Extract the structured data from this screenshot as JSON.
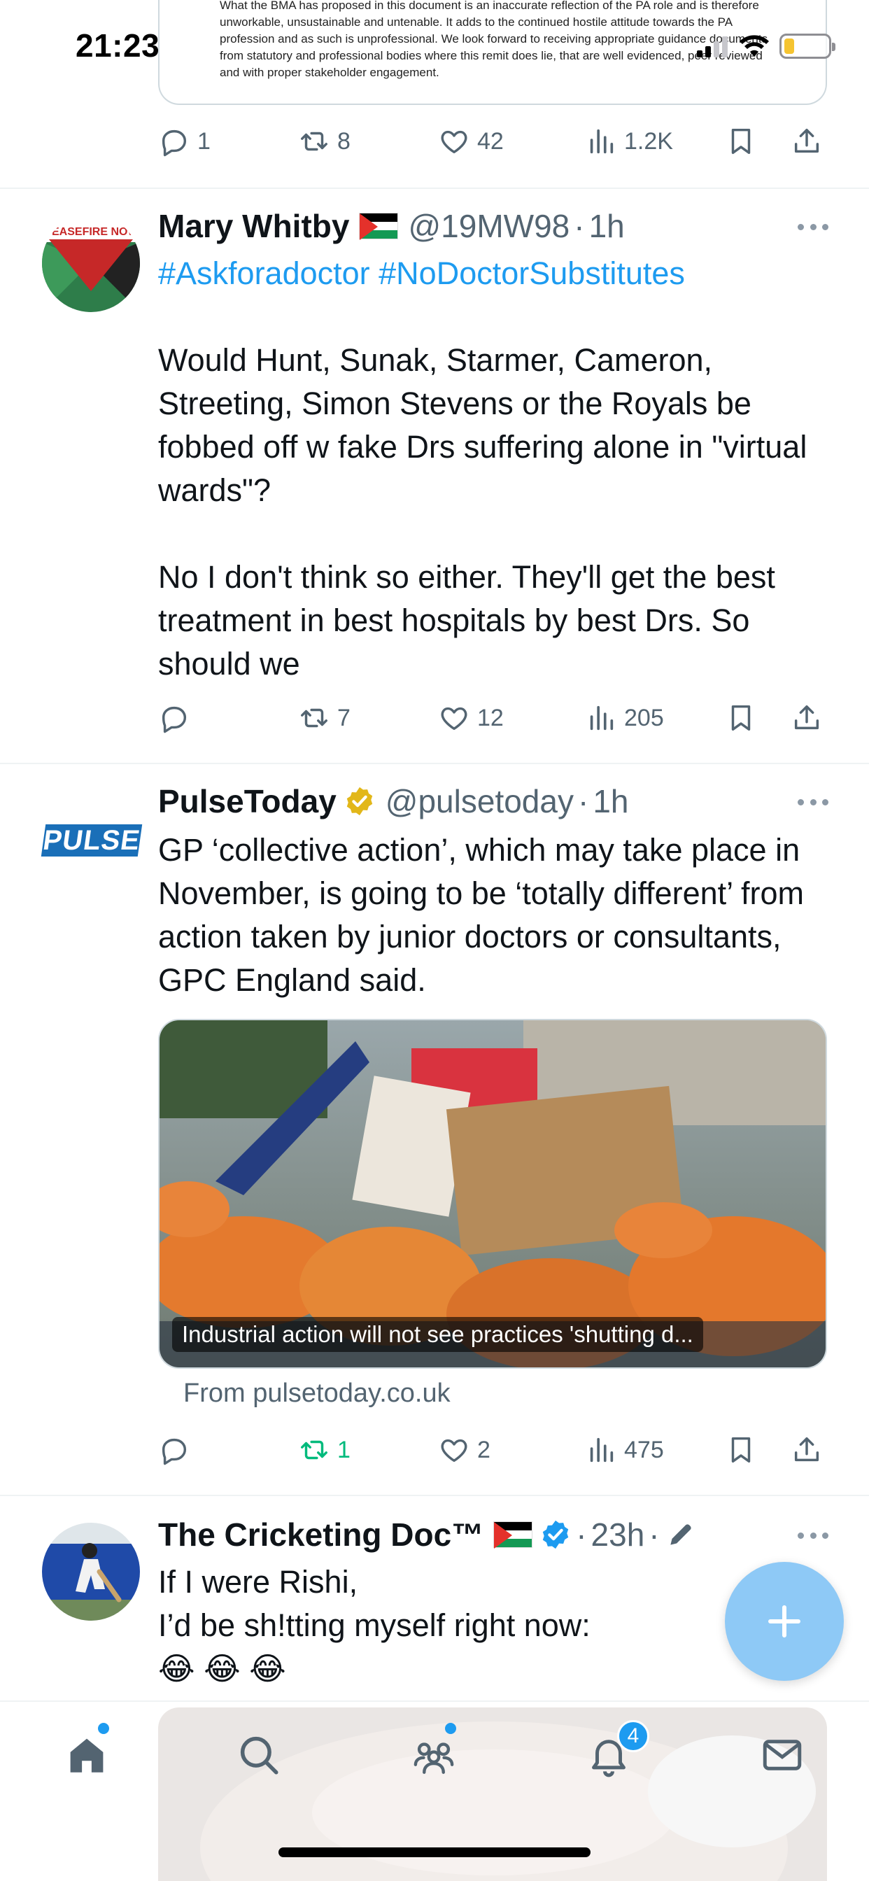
{
  "status_bar": {
    "time": "21:23"
  },
  "quoted_card": {
    "text": "What the BMA has proposed in this document is an inaccurate reflection of the PA role and is therefore unworkable, unsustainable and untenable. It adds to the continued hostile attitude towards the PA profession and as such is unprofessional. We look forward to receiving appropriate guidance documents from statutory and professional bodies where this remit does lie, that are well evidenced, peer reviewed and with proper stakeholder engagement."
  },
  "tweets": [
    {
      "actions": {
        "replies": "1",
        "reposts": "8",
        "likes": "42",
        "views": "1.2K"
      }
    },
    {
      "name": "Mary Whitby",
      "handle": "@19MW98",
      "time": "1h",
      "avatar_text": "CEASEFIRE NOW",
      "hashtags": "#Askforadoctor #NoDoctorSubstitutes",
      "text": "Would Hunt, Sunak, Starmer, Cameron, Streeting, Simon Stevens or the Royals be fobbed off w fake Drs suffering alone in \"virtual wards\"?\n\nNo I don't think so either. They'll get the best treatment in best hospitals by best Drs. So should we",
      "actions": {
        "replies": "",
        "reposts": "7",
        "likes": "12",
        "views": "205"
      }
    },
    {
      "name": "PulseToday",
      "handle": "@pulsetoday",
      "time": "1h",
      "logo_text": "PULSE",
      "text": "GP ‘collective action’, which may take place in November, is going to be ‘totally different’ from action taken by junior doctors or consultants, GPC England said.",
      "card_caption": "Industrial action will not see practices 'shutting d...",
      "card_source": "From pulsetoday.co.uk",
      "actions": {
        "replies": "",
        "reposts": "1",
        "likes": "2",
        "views": "475"
      }
    },
    {
      "name": "The Cricketing Doc™",
      "time": "23h",
      "text": "If I were Rishi,\nI’d be sh!tting myself right now:\n😂 😂 😂"
    }
  ],
  "tabbar": {
    "notifications_badge": "4"
  },
  "colors": {
    "accent": "#1d9bf0",
    "repost_active": "#00ba7c",
    "muted": "#536471"
  },
  "icons": [
    "reply-icon",
    "repost-icon",
    "like-icon",
    "views-icon",
    "bookmark-icon",
    "share-icon",
    "home-icon",
    "search-icon",
    "communities-icon",
    "notifications-icon",
    "messages-icon",
    "compose-icon"
  ]
}
